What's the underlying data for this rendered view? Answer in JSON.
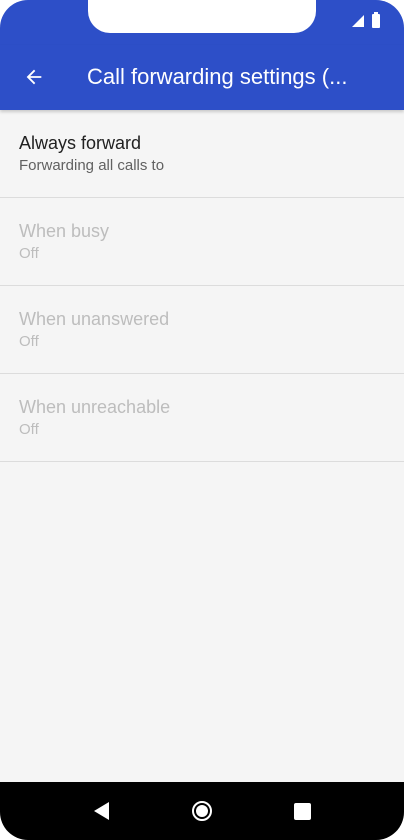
{
  "app_bar": {
    "title": "Call forwarding settings (...",
    "color": "#2d4fc8"
  },
  "settings": [
    {
      "title": "Always forward",
      "summary": "Forwarding all calls to",
      "enabled": true
    },
    {
      "title": "When busy",
      "summary": "Off",
      "enabled": false
    },
    {
      "title": "When unanswered",
      "summary": "Off",
      "enabled": false
    },
    {
      "title": "When unreachable",
      "summary": "Off",
      "enabled": false
    }
  ],
  "icons": {
    "back": "arrow-back-icon",
    "signal": "signal-icon",
    "battery": "battery-icon",
    "nav_back": "triangle-back-icon",
    "nav_home": "circle-home-icon",
    "nav_recents": "square-recents-icon"
  }
}
